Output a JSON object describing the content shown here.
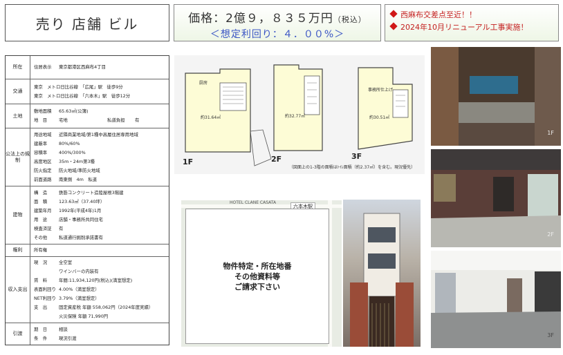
{
  "header": {
    "title": "売り 店舗 ビル",
    "price": "価格：2億９，８３５万円",
    "tax_note": "（税込）",
    "yield": "＜想定利回り：４．００%＞",
    "points": [
      "西麻布交差点至近！！",
      "2024年10月リニューアル工事実施！"
    ]
  },
  "spec": {
    "location": {
      "label": "所在",
      "key": "住居表示",
      "value": "東京都港区西麻布4丁目"
    },
    "transport": {
      "label": "交通",
      "lines": [
        "東京　メトロ日比谷線　「広尾」駅　徒歩9分",
        "東京　メトロ日比谷線　「六本木」駅　徒歩12分"
      ]
    },
    "land": {
      "label": "土地",
      "area_key": "敷地面積",
      "area": "65.63㎡(公簿)",
      "type_key": "地　目",
      "type": "宅地",
      "lease_key": "私道負担",
      "lease": "有"
    },
    "regulation": {
      "label": "公法上の規制",
      "rows": [
        {
          "k": "用途地域",
          "v": "近隣商業地域/第1種中高層住居専用地域"
        },
        {
          "k": "建蔽率",
          "v": "80%/60%"
        },
        {
          "k": "容積率",
          "v": "400%/300%"
        },
        {
          "k": "高度地区",
          "v": "35m・24m第3種"
        },
        {
          "k": "防火指定",
          "v": "防火地域/準防火地域"
        },
        {
          "k": "前面道路",
          "v": "南東側　4m　私道"
        }
      ]
    },
    "building": {
      "label": "建物",
      "rows": [
        {
          "k": "構　造",
          "v": "鉄筋コンクリート造陸屋根3階建"
        },
        {
          "k": "面　積",
          "v": "123.63㎡（37.40坪）"
        },
        {
          "k": "建築年月",
          "v": "1992年(平成4年)1月"
        },
        {
          "k": "用　途",
          "v": "店舗・事務所共同住宅"
        },
        {
          "k": "検査済証",
          "v": "有"
        },
        {
          "k": "その他",
          "v": "私道通行掘削承諾書有"
        }
      ]
    },
    "rights": {
      "label": "権利",
      "value": "所有権"
    },
    "income": {
      "label": "収入支出",
      "rows": [
        {
          "k": "現　況",
          "v": "全空室"
        },
        {
          "k": "",
          "v": "ワインバーの内装有"
        },
        {
          "k": "賃　料",
          "v": "年間:11,934,120円(税込)(満室想定)"
        },
        {
          "k": "表面利回り",
          "v": "4.00%（満室想定）"
        },
        {
          "k": "NET利回り",
          "v": "3.79%（満室想定）"
        },
        {
          "k": "支　出",
          "v": "固定資産税 年額 558,062円（2024年度実績）"
        },
        {
          "k": "",
          "v": "火災保険 年額 71,990円"
        }
      ]
    },
    "handover": {
      "label": "引渡",
      "rows": [
        {
          "k": "期　日",
          "v": "相談"
        },
        {
          "k": "条　件",
          "v": "現況引渡"
        }
      ]
    }
  },
  "floor_plans": {
    "floors": [
      {
        "label": "1F",
        "room": "厨房",
        "area": "約31.64㎡"
      },
      {
        "label": "2F",
        "room": "",
        "area": "約32.77㎡"
      },
      {
        "label": "3F",
        "room": "事務所仕上げ",
        "area": "約30.51㎡"
      }
    ],
    "note": "（図面上の1-3階の面積はﾄｲﾚ面積（約2.37㎡）を含む。現況優先）"
  },
  "map": {
    "overlay_lines": [
      "物件特定・所在地番",
      "その他資料等",
      "ご請求下さい"
    ],
    "station_tag": "六本木駅",
    "street_label": "HOTEL CLANE CASATA"
  },
  "photos": [
    {
      "name": "front",
      "tag": ""
    },
    {
      "name": "1f",
      "tag": "1F"
    },
    {
      "name": "2f",
      "tag": "2F"
    },
    {
      "name": "3f",
      "tag": "3F"
    }
  ]
}
